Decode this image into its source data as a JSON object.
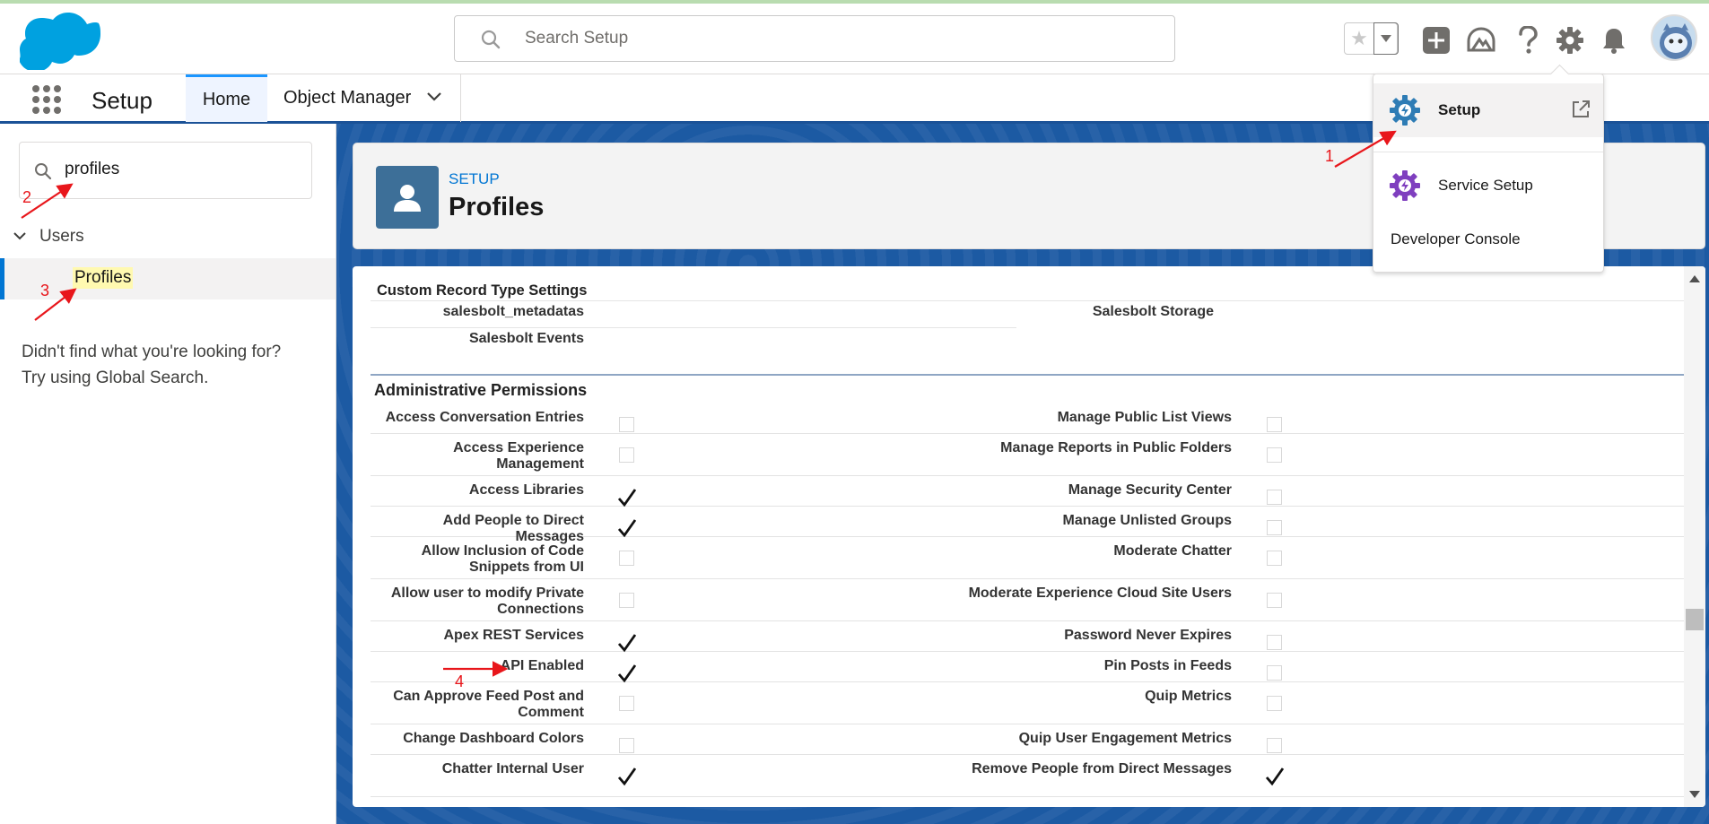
{
  "header": {
    "search_placeholder": "Search Setup"
  },
  "context_bar": {
    "app_name": "Setup",
    "tabs": [
      {
        "label": "Home",
        "active": true
      },
      {
        "label": "Object Manager",
        "active": false
      }
    ]
  },
  "left_nav": {
    "quick_find_value": "profiles",
    "tree_parent": "Users",
    "tree_child": "Profiles",
    "not_found_line1": "Didn't find what you're looking for?",
    "not_found_line2": "Try using Global Search."
  },
  "page_header": {
    "eyebrow": "SETUP",
    "title": "Profiles"
  },
  "record_type_section": {
    "title": "Custom Record Type Settings",
    "left": [
      "salesbolt_metadatas",
      "Salesbolt Events"
    ],
    "right": [
      "Salesbolt Storage"
    ]
  },
  "admin_section": {
    "title": "Administrative Permissions",
    "rows": [
      {
        "left": "Access Conversation Entries",
        "left_checked": false,
        "right": "Manage Public List Views",
        "right_checked": false
      },
      {
        "left": "Access Experience Management",
        "left_checked": false,
        "right": "Manage Reports in Public Folders",
        "right_checked": false
      },
      {
        "left": "Access Libraries",
        "left_checked": true,
        "right": "Manage Security Center",
        "right_checked": false
      },
      {
        "left": "Add People to Direct Messages",
        "left_checked": true,
        "right": "Manage Unlisted Groups",
        "right_checked": false
      },
      {
        "left": "Allow Inclusion of Code Snippets from UI",
        "left_checked": false,
        "right": "Moderate Chatter",
        "right_checked": false
      },
      {
        "left": "Allow user to modify Private Connections",
        "left_checked": false,
        "right": "Moderate Experience Cloud Site Users",
        "right_checked": false
      },
      {
        "left": "Apex REST Services",
        "left_checked": true,
        "right": "Password Never Expires",
        "right_checked": false
      },
      {
        "left": "API Enabled",
        "left_checked": true,
        "right": "Pin Posts in Feeds",
        "right_checked": false
      },
      {
        "left": "Can Approve Feed Post and Comment",
        "left_checked": false,
        "right": "Quip Metrics",
        "right_checked": false
      },
      {
        "left": "Change Dashboard Colors",
        "left_checked": false,
        "right": "Quip User Engagement Metrics",
        "right_checked": false
      },
      {
        "left": "Chatter Internal User",
        "left_checked": true,
        "right": "Remove People from Direct Messages",
        "right_checked": true
      }
    ]
  },
  "setup_menu": {
    "items": [
      {
        "label": "Setup"
      },
      {
        "label": "Service Setup"
      },
      {
        "label": "Developer Console"
      }
    ]
  },
  "annotations": {
    "numbers": [
      "1",
      "2",
      "3",
      "4"
    ],
    "color": "#e8161b"
  },
  "colors": {
    "brand_blue": "#0176d3",
    "salesforce_cloud": "#00a1e0",
    "header_bar": "#1b5297",
    "setup_gear": "#2e7cb5",
    "service_gear": "#7f3fbf"
  }
}
